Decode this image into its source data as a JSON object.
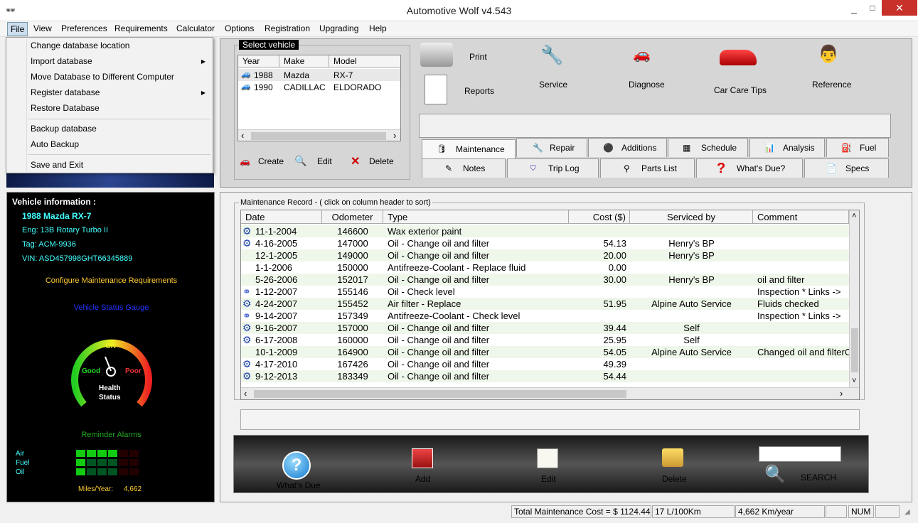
{
  "window": {
    "title": "Automotive Wolf v4.543",
    "min": "_",
    "max": "□",
    "close": "✕"
  },
  "menu": [
    "File",
    "View",
    "Preferences",
    "Requirements",
    "Calculator",
    "Options",
    "Registration",
    "Upgrading",
    "Help"
  ],
  "file_menu": {
    "items": [
      "Change database location",
      "Import database",
      "Move Database to Different Computer",
      "Register database",
      "Restore Database",
      "Backup database",
      "Auto Backup",
      "Save and Exit"
    ],
    "arrow": "▶"
  },
  "vehicle_info": {
    "heading": "Vehicle information :",
    "name": "1988 Mazda RX-7",
    "eng": "Eng:  13B Rotary Turbo II",
    "tag": "Tag:  ACM-9936",
    "vin": "VIN:  ASD457998GHT66345889",
    "configure": "Configure Maintenance Requirements",
    "gauge_title": "Vehicle Status Gauge",
    "gauge_ok": "OK",
    "gauge_good": "Good",
    "gauge_poor": "Poor",
    "gauge_health": "Health",
    "gauge_status": "Status",
    "reminder": "Reminder Alarms",
    "alarm_labels": [
      "Air",
      "Fuel",
      "Oil"
    ],
    "alarm_levels": [
      4,
      1,
      1
    ],
    "alarm_total": 6,
    "miles_label": "Miles/Year:",
    "miles_value": "4,662"
  },
  "select_vehicle": {
    "label": "Select vehicle",
    "headers": [
      "Year",
      "Make",
      "Model"
    ],
    "rows": [
      [
        "1988",
        "Mazda",
        "RX-7"
      ],
      [
        "1990",
        "CADILLAC",
        "ELDORADO"
      ]
    ],
    "create": "Create",
    "edit": "Edit",
    "delete": "Delete",
    "scroll_left": "‹",
    "scroll_right": "›"
  },
  "toolbar": {
    "print": "Print",
    "reports": "Reports",
    "service": "Service",
    "diagnose": "Diagnose",
    "car_care": "Car Care Tips",
    "reference": "Reference"
  },
  "tabs": {
    "row1": [
      "Maintenance",
      "Repair",
      "Additions",
      "Schedule",
      "Analysis",
      "Fuel"
    ],
    "row2": [
      "Notes",
      "Trip Log",
      "Parts List",
      "What's Due?",
      "Specs"
    ]
  },
  "maintenance": {
    "label": "Maintenance Record - ( click on column header to sort)",
    "headers": [
      "Date",
      "Odometer",
      "Type",
      "Cost ($)",
      "Serviced by",
      "Comment"
    ],
    "rows": [
      [
        "11-1-2004",
        "146600",
        "Wax exterior paint",
        "",
        "",
        ""
      ],
      [
        "4-16-2005",
        "147000",
        "Oil - Change oil and filter",
        "54.13",
        "Henry's BP",
        ""
      ],
      [
        "12-1-2005",
        "149000",
        "Oil - Change oil and filter",
        "20.00",
        "Henry's BP",
        ""
      ],
      [
        "1-1-2006",
        "150000",
        "Antifreeze-Coolant - Replace fluid",
        "0.00",
        "",
        ""
      ],
      [
        "5-26-2006",
        "152017",
        "Oil - Change oil and filter",
        "30.00",
        "Henry's BP",
        "oil and filter"
      ],
      [
        "1-12-2007",
        "155146",
        "Oil - Check level",
        "",
        "",
        "Inspection  * Links ->"
      ],
      [
        "4-24-2007",
        "155452",
        "Air filter - Replace",
        "51.95",
        "Alpine Auto Service",
        "Fluids checked"
      ],
      [
        "9-14-2007",
        "157349",
        "Antifreeze-Coolant - Check level",
        "",
        "",
        "Inspection  * Links ->"
      ],
      [
        "9-16-2007",
        "157000",
        "Oil - Change oil and filter",
        "39.44",
        "Self",
        ""
      ],
      [
        "6-17-2008",
        "160000",
        "Oil - Change oil and filter",
        "25.95",
        "Self",
        ""
      ],
      [
        "10-1-2009",
        "164900",
        "Oil - Change oil and filter",
        "54.05",
        "Alpine Auto Service",
        "Changed oil and filterC"
      ],
      [
        "4-17-2010",
        "167426",
        "Oil - Change oil and filter",
        "49.39",
        "",
        ""
      ],
      [
        "9-12-2013",
        "183349",
        "Oil - Change oil and filter",
        "54.44",
        "",
        ""
      ]
    ],
    "row_icons": [
      "gear",
      "gear",
      "",
      "",
      "",
      "link",
      "gear",
      "link",
      "gear",
      "gear",
      "",
      "gear",
      "gear"
    ],
    "scroll_up": "˄",
    "scroll_down": "˅",
    "scroll_left": "‹",
    "scroll_right": "›"
  },
  "bottom": {
    "whats_due": "What's Due",
    "add": "Add",
    "edit": "Edit",
    "delete": "Delete",
    "search": "SEARCH",
    "search_value": ""
  },
  "status": {
    "total": "Total Maintenance Cost = $ 1124.44",
    "fuel": "17 L/100Km",
    "km": "4,662 Km/year",
    "num": "NUM"
  }
}
